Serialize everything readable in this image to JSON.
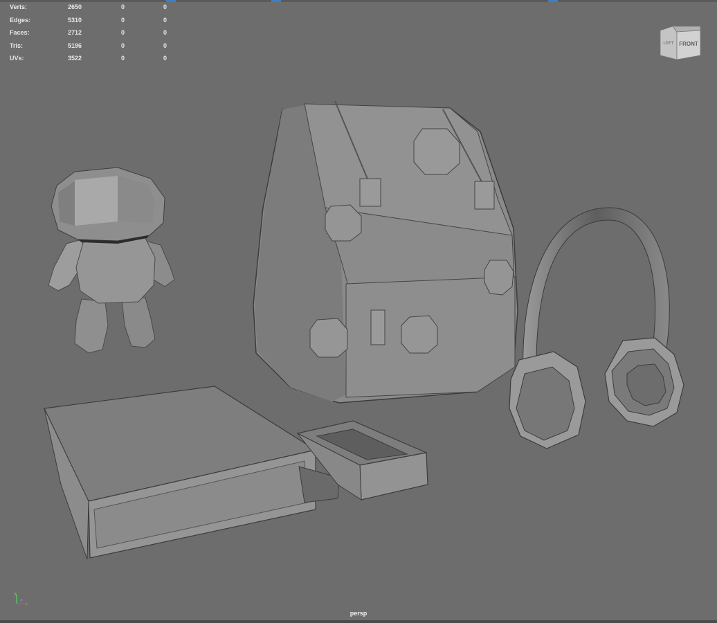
{
  "hud": {
    "rows": [
      {
        "label": "Verts:",
        "v1": "2650",
        "v2": "0",
        "v3": "0"
      },
      {
        "label": "Edges:",
        "v1": "5310",
        "v2": "0",
        "v3": "0"
      },
      {
        "label": "Faces:",
        "v1": "2712",
        "v2": "0",
        "v3": "0"
      },
      {
        "label": "Tris:",
        "v1": "5196",
        "v2": "0",
        "v3": "0"
      },
      {
        "label": "UVs:",
        "v1": "3522",
        "v2": "0",
        "v3": "0"
      }
    ]
  },
  "viewcube": {
    "front_label": "FRONT",
    "side_label": "LEFT"
  },
  "camera_label": "persp",
  "axis": {
    "x": "x",
    "y": "y",
    "z": "z"
  },
  "colors": {
    "background": "#6d6d6d",
    "model": "#8a8a8a",
    "accent": "#3d7fc4"
  }
}
